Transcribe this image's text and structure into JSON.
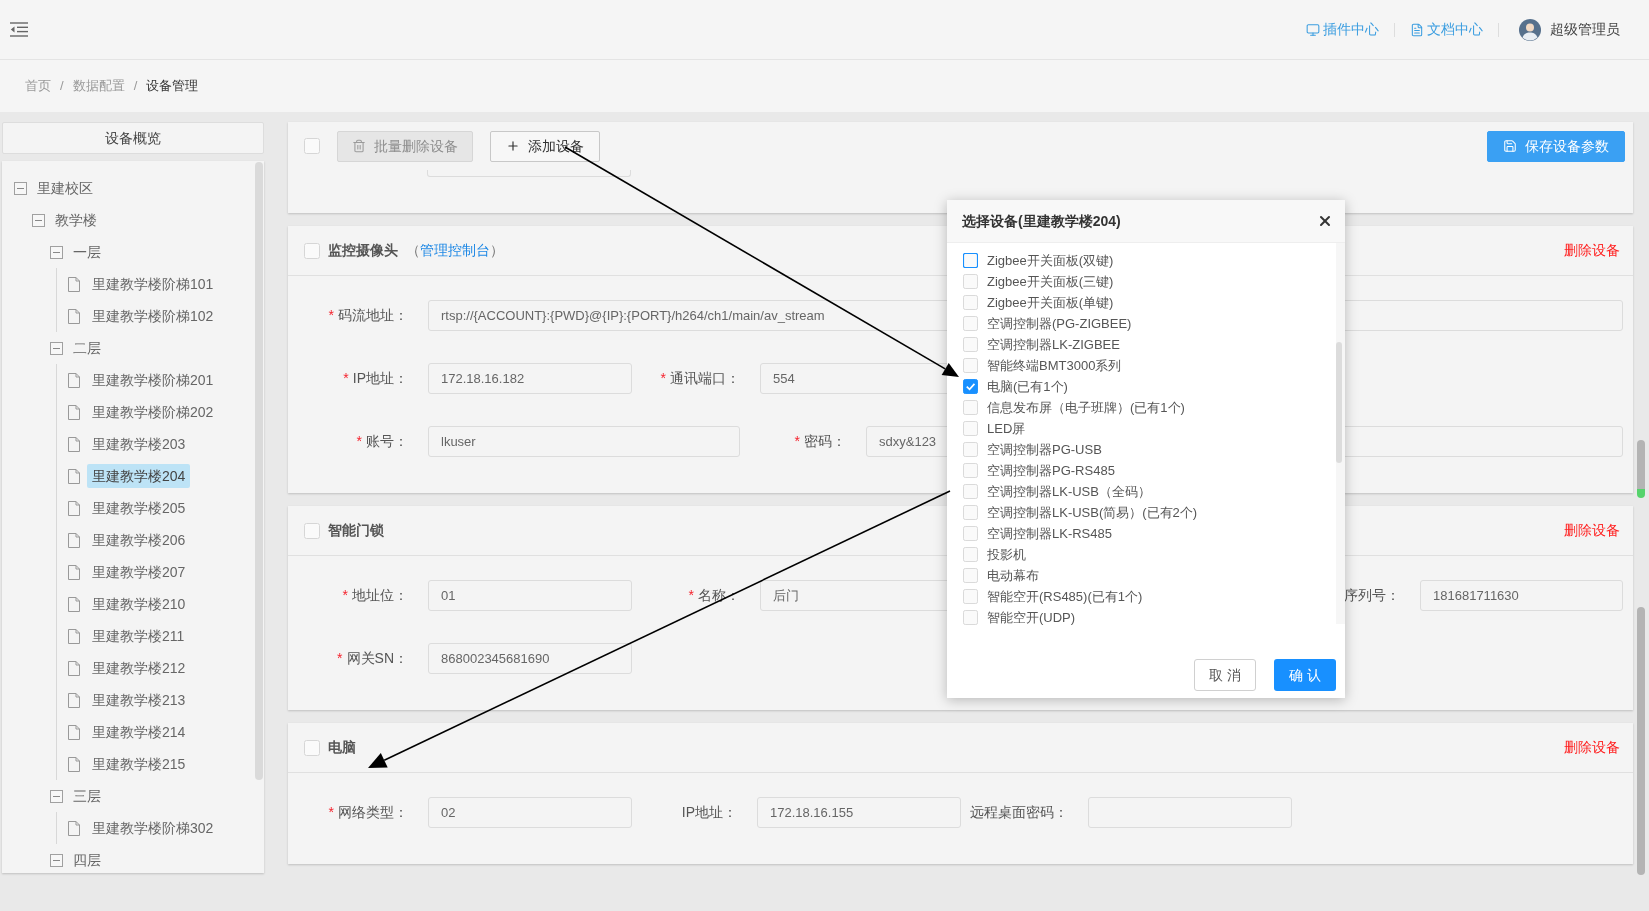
{
  "header": {
    "links": [
      {
        "label": "插件中心"
      },
      {
        "label": "文档中心"
      }
    ],
    "user": {
      "name": "超级管理员"
    }
  },
  "breadcrumb": [
    {
      "kind": "link",
      "text": "首页"
    },
    {
      "kind": "separator",
      "text": "/"
    },
    {
      "kind": "link",
      "text": "数据配置"
    },
    {
      "kind": "separator",
      "text": "/"
    },
    {
      "kind": "current",
      "text": "设备管理"
    }
  ],
  "sidebar": {
    "title": "设备概览",
    "tree": [
      {
        "label": "里建校区",
        "expanded": true,
        "selected": false,
        "children": [
          {
            "label": "教学楼",
            "expanded": true,
            "selected": false,
            "children": [
              {
                "label": "一层",
                "expanded": true,
                "selected": false,
                "children": [
                  {
                    "label": "里建教学楼阶梯101",
                    "selected": false
                  },
                  {
                    "label": "里建教学楼阶梯102",
                    "selected": false
                  }
                ]
              },
              {
                "label": "二层",
                "expanded": true,
                "selected": false,
                "children": [
                  {
                    "label": "里建教学楼阶梯201",
                    "selected": false
                  },
                  {
                    "label": "里建教学楼阶梯202",
                    "selected": false
                  },
                  {
                    "label": "里建教学楼203",
                    "selected": false
                  },
                  {
                    "label": "里建教学楼204",
                    "selected": true
                  },
                  {
                    "label": "里建教学楼205",
                    "selected": false
                  },
                  {
                    "label": "里建教学楼206",
                    "selected": false
                  },
                  {
                    "label": "里建教学楼207",
                    "selected": false
                  },
                  {
                    "label": "里建教学楼210",
                    "selected": false
                  },
                  {
                    "label": "里建教学楼211",
                    "selected": false
                  },
                  {
                    "label": "里建教学楼212",
                    "selected": false
                  },
                  {
                    "label": "里建教学楼213",
                    "selected": false
                  },
                  {
                    "label": "里建教学楼214",
                    "selected": false
                  },
                  {
                    "label": "里建教学楼215",
                    "selected": false
                  }
                ]
              },
              {
                "label": "三层",
                "expanded": true,
                "selected": false,
                "children": [
                  {
                    "label": "里建教学楼阶梯302",
                    "selected": false
                  }
                ]
              },
              {
                "label": "四层",
                "expanded": true,
                "selected": false
              }
            ]
          }
        ]
      }
    ]
  },
  "toolbar": {
    "select_all": {
      "checked": false
    },
    "buttons": [
      {
        "kind": "delete",
        "label": "批量删除设备",
        "disabled": true
      },
      {
        "kind": "add",
        "label": "添加设备",
        "disabled": false
      },
      {
        "kind": "save",
        "label": "保存设备参数",
        "disabled": false
      }
    ]
  },
  "devices": [
    {
      "title": "监控摄像头",
      "checked": false,
      "note": {
        "open": "（",
        "link": "管理控制台",
        "close": "）"
      },
      "delete_label": "删除设备",
      "rows": [
        [
          {
            "mark": "*",
            "label": "码流地址：",
            "value": "rtsp://{ACCOUNT}:{PWD}@{IP}:{PORT}/h264/ch1/main/av_stream"
          }
        ],
        [
          {
            "mark": "*",
            "label": "IP地址：",
            "value": "172.18.16.182"
          },
          {
            "mark": "*",
            "label": "通讯端口：",
            "value": "554"
          }
        ],
        [
          {
            "mark": "*",
            "label": "账号：",
            "value": "lkuser"
          },
          {
            "mark": "*",
            "label": "密码：",
            "value": "sdxy&123"
          }
        ]
      ]
    },
    {
      "title": "智能门锁",
      "checked": false,
      "delete_label": "删除设备",
      "rows": [
        [
          {
            "mark": "*",
            "label": "地址位：",
            "value": "01"
          },
          {
            "mark": "*",
            "label": "名称：",
            "value": "后门"
          },
          {
            "label": "序列号：",
            "value": "181681711630"
          }
        ],
        [
          {
            "mark": "*",
            "label": "网关SN：",
            "value": "868002345681690"
          }
        ]
      ]
    },
    {
      "title": "电脑",
      "checked": false,
      "delete_label": "删除设备",
      "rows": [
        [
          {
            "mark": "*",
            "label": "网络类型：",
            "value": "02"
          },
          {
            "label": "IP地址：",
            "value": "172.18.16.155"
          },
          {
            "label": "远程桌面密码："
          }
        ]
      ]
    }
  ],
  "dialog": {
    "title": "选择设备(里建教学楼204)",
    "options": [
      {
        "label": "Zigbee开关面板(双键)",
        "checked": false,
        "focused": true
      },
      {
        "label": "Zigbee开关面板(三键)",
        "checked": false,
        "focused": false
      },
      {
        "label": "Zigbee开关面板(单键)",
        "checked": false,
        "focused": false
      },
      {
        "label": "空调控制器(PG-ZIGBEE)",
        "checked": false,
        "focused": false
      },
      {
        "label": "空调控制器LK-ZIGBEE",
        "checked": false,
        "focused": false
      },
      {
        "label": "智能终端BMT3000系列",
        "checked": false,
        "focused": false
      },
      {
        "label": "电脑(已有1个)",
        "checked": true,
        "focused": false
      },
      {
        "label": "信息发布屏（电子班牌）(已有1个)",
        "checked": false,
        "focused": false
      },
      {
        "label": "LED屏",
        "checked": false,
        "focused": false
      },
      {
        "label": "空调控制器PG-USB",
        "checked": false,
        "focused": false
      },
      {
        "label": "空调控制器PG-RS485",
        "checked": false,
        "focused": false
      },
      {
        "label": "空调控制器LK-USB（全码）",
        "checked": false,
        "focused": false
      },
      {
        "label": "空调控制器LK-USB(简易）(已有2个)",
        "checked": false,
        "focused": false
      },
      {
        "label": "空调控制器LK-RS485",
        "checked": false,
        "focused": false
      },
      {
        "label": "投影机",
        "checked": false,
        "focused": false
      },
      {
        "label": "电动幕布",
        "checked": false,
        "focused": false
      },
      {
        "label": "智能空开(RS485)(已有1个)",
        "checked": false,
        "focused": false
      },
      {
        "label": "智能空开(UDP)",
        "checked": false,
        "focused": false
      }
    ],
    "buttons": [
      {
        "kind": "cancel",
        "label": "取 消"
      },
      {
        "kind": "confirm",
        "label": "确 认"
      }
    ]
  }
}
